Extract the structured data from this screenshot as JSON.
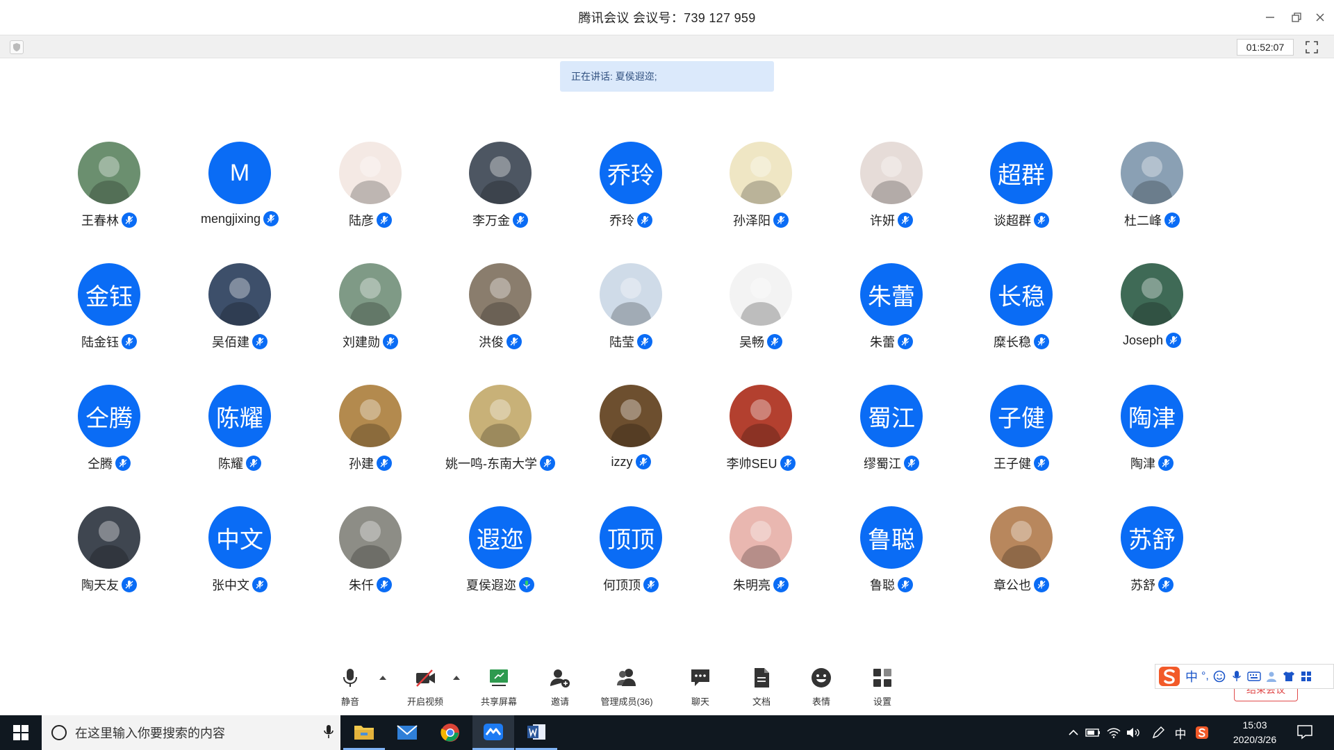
{
  "window": {
    "title": "腾讯会议 会议号：739 127 959",
    "timer": "01:52:07"
  },
  "speaking": {
    "text": "正在讲话: 夏侯遐迩;"
  },
  "participants": [
    {
      "name": "王春林",
      "avatar_type": "photo",
      "avatar_text": "",
      "color": "#6b8f6f"
    },
    {
      "name": "mengjixing",
      "avatar_type": "text",
      "avatar_text": "M",
      "color": "#0a6cf5"
    },
    {
      "name": "陆彦",
      "avatar_type": "photo",
      "avatar_text": "",
      "color": "#f4e9e4"
    },
    {
      "name": "李万金",
      "avatar_type": "photo",
      "avatar_text": "",
      "color": "#4d5662"
    },
    {
      "name": "乔玲",
      "avatar_type": "text",
      "avatar_text": "乔玲",
      "color": "#0a6cf5"
    },
    {
      "name": "孙泽阳",
      "avatar_type": "photo",
      "avatar_text": "",
      "color": "#efe6c4"
    },
    {
      "name": "许妍",
      "avatar_type": "photo",
      "avatar_text": "",
      "color": "#e6dcd8"
    },
    {
      "name": "谈超群",
      "avatar_type": "text",
      "avatar_text": "超群",
      "color": "#0a6cf5"
    },
    {
      "name": "杜二峰",
      "avatar_type": "photo",
      "avatar_text": "",
      "color": "#8aa0b4"
    },
    {
      "name": "陆金钰",
      "avatar_type": "text",
      "avatar_text": "金钰",
      "color": "#0a6cf5"
    },
    {
      "name": "吴佰建",
      "avatar_type": "photo",
      "avatar_text": "",
      "color": "#3d4f6a"
    },
    {
      "name": "刘建勋",
      "avatar_type": "photo",
      "avatar_text": "",
      "color": "#7f9a86"
    },
    {
      "name": "洪俊",
      "avatar_type": "photo",
      "avatar_text": "",
      "color": "#8a7d6d"
    },
    {
      "name": "陆莹",
      "avatar_type": "photo",
      "avatar_text": "",
      "color": "#cfdbe8"
    },
    {
      "name": "吴畅",
      "avatar_type": "photo",
      "avatar_text": "",
      "color": "#f3f3f3"
    },
    {
      "name": "朱蕾",
      "avatar_type": "text",
      "avatar_text": "朱蕾",
      "color": "#0a6cf5"
    },
    {
      "name": "糜长稳",
      "avatar_type": "text",
      "avatar_text": "长稳",
      "color": "#0a6cf5"
    },
    {
      "name": "Joseph",
      "avatar_type": "photo",
      "avatar_text": "",
      "color": "#3f6a56"
    },
    {
      "name": "仝腾",
      "avatar_type": "text",
      "avatar_text": "仝腾",
      "color": "#0a6cf5"
    },
    {
      "name": "陈耀",
      "avatar_type": "text",
      "avatar_text": "陈耀",
      "color": "#0a6cf5"
    },
    {
      "name": "孙建",
      "avatar_type": "photo",
      "avatar_text": "",
      "color": "#b38a4e"
    },
    {
      "name": "姚一鸣-东南大学",
      "avatar_type": "photo",
      "avatar_text": "",
      "color": "#c8b178"
    },
    {
      "name": "izzy",
      "avatar_type": "photo",
      "avatar_text": "",
      "color": "#6d4f2f"
    },
    {
      "name": "李帅SEU",
      "avatar_type": "photo",
      "avatar_text": "",
      "color": "#b3402f"
    },
    {
      "name": "缪蜀江",
      "avatar_type": "text",
      "avatar_text": "蜀江",
      "color": "#0a6cf5"
    },
    {
      "name": "王子健",
      "avatar_type": "text",
      "avatar_text": "子健",
      "color": "#0a6cf5"
    },
    {
      "name": "陶津",
      "avatar_type": "text",
      "avatar_text": "陶津",
      "color": "#0a6cf5"
    },
    {
      "name": "陶天友",
      "avatar_type": "photo",
      "avatar_text": "",
      "color": "#3f4650"
    },
    {
      "name": "张中文",
      "avatar_type": "text",
      "avatar_text": "中文",
      "color": "#0a6cf5"
    },
    {
      "name": "朱仟",
      "avatar_type": "photo",
      "avatar_text": "",
      "color": "#8d8d86"
    },
    {
      "name": "夏侯遐迩",
      "avatar_type": "text",
      "avatar_text": "遐迩",
      "color": "#0a6cf5",
      "speaking": true
    },
    {
      "name": "何顶顶",
      "avatar_type": "text",
      "avatar_text": "顶顶",
      "color": "#0a6cf5"
    },
    {
      "name": "朱明亮",
      "avatar_type": "photo",
      "avatar_text": "",
      "color": "#e9b7b0"
    },
    {
      "name": "鲁聪",
      "avatar_type": "text",
      "avatar_text": "鲁聪",
      "color": "#0a6cf5"
    },
    {
      "name": "章公也",
      "avatar_type": "photo",
      "avatar_text": "",
      "color": "#b8875d"
    },
    {
      "name": "苏舒",
      "avatar_type": "text",
      "avatar_text": "苏舒",
      "color": "#0a6cf5"
    }
  ],
  "toolbar": {
    "mute_label": "静音",
    "video_label": "开启视频",
    "share_label": "共享屏幕",
    "invite_label": "邀请",
    "members_label": "管理成员(36)",
    "chat_label": "聊天",
    "docs_label": "文档",
    "emoji_label": "表情",
    "settings_label": "设置",
    "end_label": "结束会议"
  },
  "ime": {
    "mode": "中",
    "punct": "°,"
  },
  "taskbar": {
    "search_placeholder": "在这里输入你要搜索的内容",
    "ime_indicator": "中",
    "time": "15:03",
    "date": "2020/3/26"
  },
  "colors": {
    "accent": "#0a6cf5",
    "speaking_banner": "#dbe9fb",
    "taskbar": "#101820",
    "end_button": "#e04a4a"
  }
}
